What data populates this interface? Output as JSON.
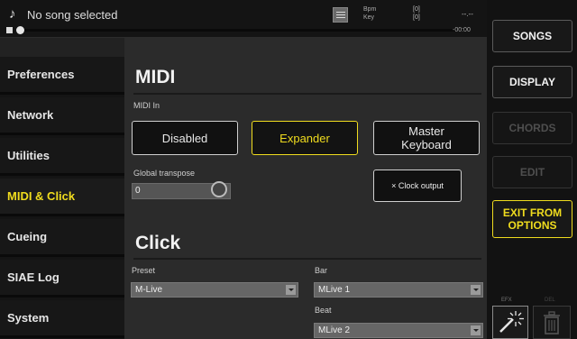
{
  "topbar": {
    "song_title": "No song selected",
    "bpm_label": "Bpm",
    "bpm_value": "[0]",
    "key_label": "Key",
    "key_value": "[0]",
    "time_top": "--.--",
    "time_remaining": "-00:00",
    "progress": 0
  },
  "right_buttons": {
    "songs": "SONGS",
    "display": "DISPLAY",
    "chords": "CHORDS",
    "edit": "EDIT",
    "exit_from_options": "EXIT FROM OPTIONS",
    "fx_label": "EFX",
    "delete_label": "DEL"
  },
  "nav": {
    "items": [
      {
        "label": "Preferences"
      },
      {
        "label": "Network"
      },
      {
        "label": "Utilities"
      },
      {
        "label": "MIDI & Click"
      },
      {
        "label": "Cueing"
      },
      {
        "label": "SIAE Log"
      },
      {
        "label": "System"
      }
    ],
    "active_index": 3
  },
  "midi": {
    "title": "MIDI",
    "midi_in_label": "MIDI In",
    "options": [
      "Disabled",
      "Expander",
      "Master Keyboard"
    ],
    "selected": "Expander",
    "global_transpose_label": "Global transpose",
    "global_transpose_value": "0",
    "clock_output_label": "× Clock output"
  },
  "click": {
    "title": "Click",
    "preset_label": "Preset",
    "preset_value": "M-Live",
    "bar_label": "Bar",
    "bar_value": "MLive 1",
    "beat_label": "Beat",
    "beat_value": "MLive 2"
  },
  "colors": {
    "accent": "#f0dc1e",
    "background": "#2b2b2b",
    "panel": "#141414"
  }
}
